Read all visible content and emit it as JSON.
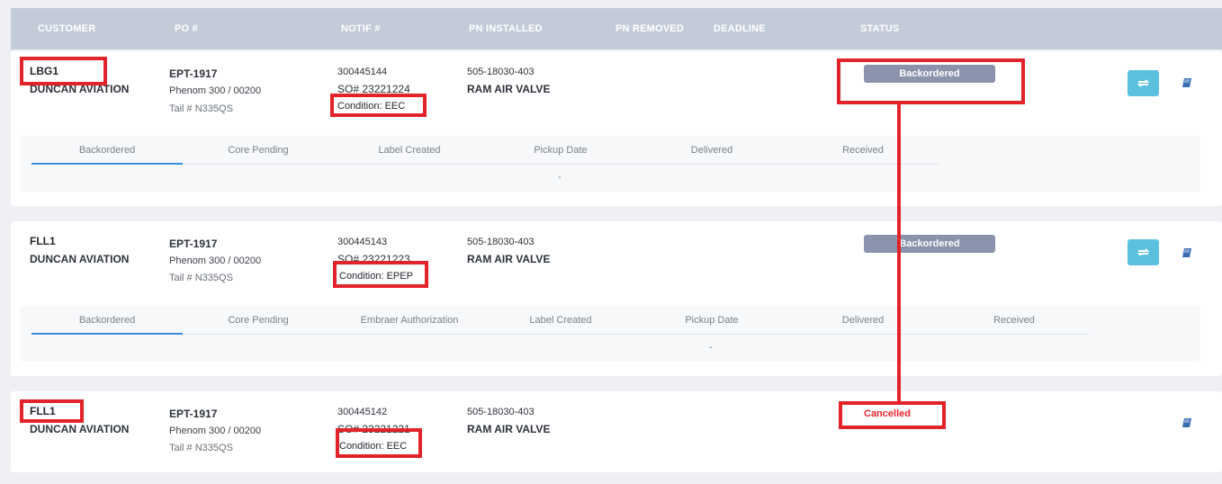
{
  "header": {
    "customer": "CUSTOMER",
    "po": "PO #",
    "notif": "NOTIF #",
    "pn_installed": "PN INSTALLED",
    "pn_removed": "PN REMOVED",
    "deadline": "DEADLINE",
    "status": "STATUS"
  },
  "orders": [
    {
      "customer_code": "LBG1",
      "customer_name": "DUNCAN AVIATION",
      "po": "EPT-1917",
      "aircraft": "Phenom 300 / 00200",
      "tail": "Tail # N335QS",
      "notif": "300445144",
      "so": "SO# 23221224",
      "condition": "Condition: EEC",
      "pn_number": "505-18030-403",
      "pn_desc": "RAM AIR VALVE",
      "status": "Backordered",
      "steps": [
        "Backordered",
        "Core Pending",
        "Label Created",
        "Pickup Date",
        "Delivered",
        "Received"
      ],
      "step_detail": "-"
    },
    {
      "customer_code": "FLL1",
      "customer_name": "DUNCAN AVIATION",
      "po": "EPT-1917",
      "aircraft": "Phenom 300 / 00200",
      "tail": "Tail # N335QS",
      "notif": "300445143",
      "so": "SO# 23221223",
      "condition": "Condition: EPEP",
      "pn_number": "505-18030-403",
      "pn_desc": "RAM AIR VALVE",
      "status": "Backordered",
      "steps": [
        "Backordered",
        "Core Pending",
        "Embraer Authorization",
        "Label Created",
        "Pickup Date",
        "Delivered",
        "Received"
      ],
      "step_detail": "-"
    },
    {
      "customer_code": "FLL1",
      "customer_name": "DUNCAN AVIATION",
      "po": "EPT-1917",
      "aircraft": "Phenom 300 / 00200",
      "tail": "Tail # N335QS",
      "notif": "300445142",
      "so": "SO# 23221221",
      "condition": "Condition: EEC",
      "pn_number": "505-18030-403",
      "pn_desc": "RAM AIR VALVE",
      "status": "Cancelled"
    }
  ],
  "icons": {
    "refresh": "refresh-icon",
    "book": "book-icon"
  },
  "colors": {
    "header_bg": "#c3cbd9",
    "badge_bg": "#8a93ab",
    "refresh_btn": "#5bc0de",
    "annotation_red": "#e2232a",
    "cancelled_text": "#e8222b",
    "step_active": "#3b8fd9"
  }
}
